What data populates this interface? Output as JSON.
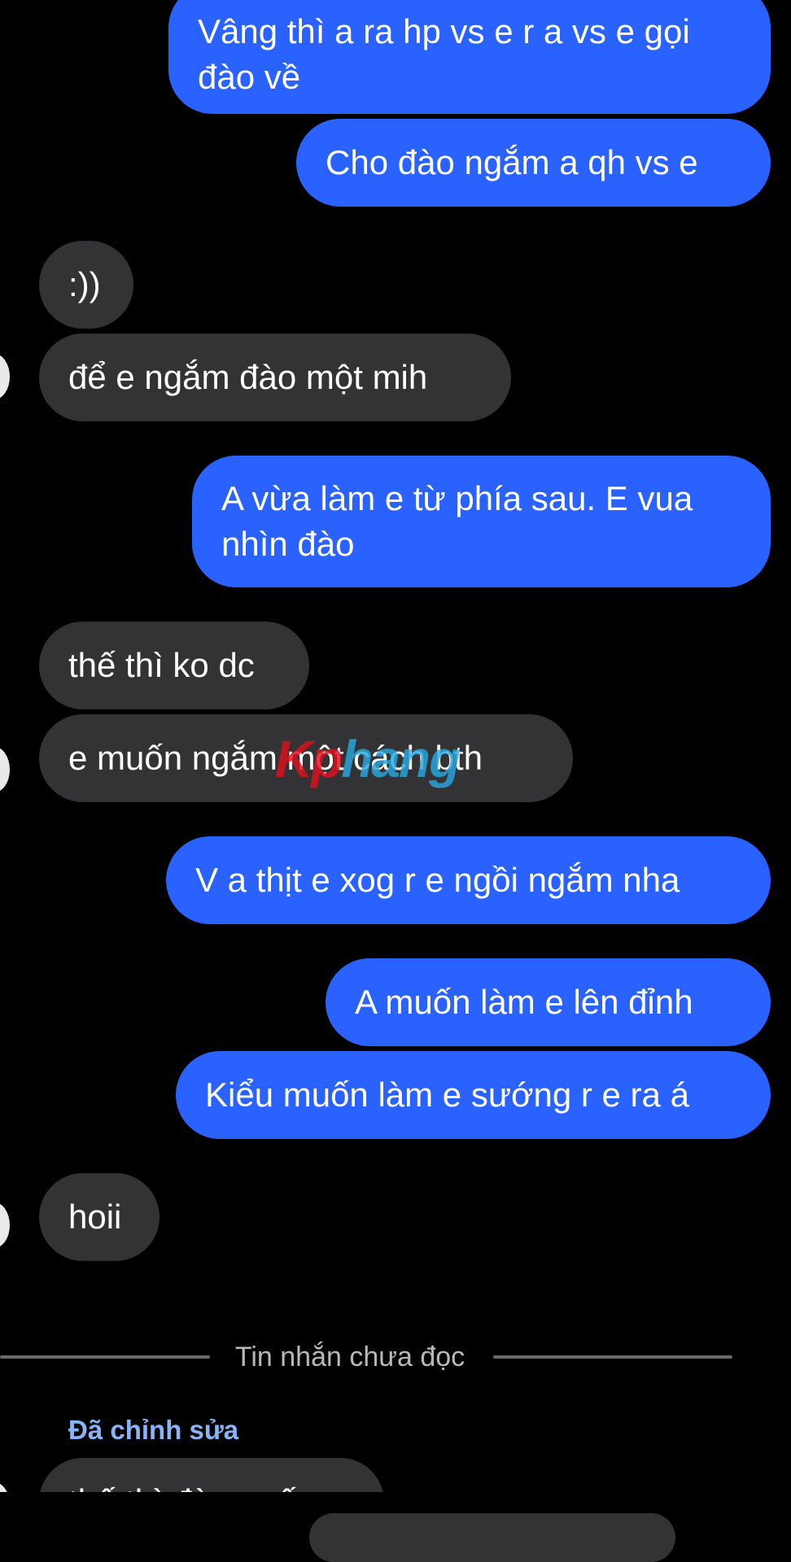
{
  "messages": [
    {
      "side": "sent",
      "text": "Vâng thì a ra hp vs e r a vs e gọi\nđào về"
    },
    {
      "side": "sent",
      "text": "Cho đào ngắm a qh vs e"
    },
    {
      "side": "received",
      "text": ":))"
    },
    {
      "side": "received",
      "text": "để e ngắm đào một mih"
    },
    {
      "side": "sent",
      "text": "A vừa làm e từ phía sau. E vua\nnhìn đào"
    },
    {
      "side": "received",
      "text": "thế thì ko dc"
    },
    {
      "side": "received",
      "text": "e muốn ngắm một cách bth"
    },
    {
      "side": "sent",
      "text": "V a thịt e xog r e ngồi ngắm nha"
    },
    {
      "side": "sent",
      "text": "A muốn làm e lên đỉnh"
    },
    {
      "side": "sent",
      "text": "Kiểu muốn làm e sướng r e ra á"
    },
    {
      "side": "received",
      "text": "hoii"
    },
    {
      "side": "received",
      "text": "thế thì đào ... ấy"
    }
  ],
  "unread_divider": "Tin nhắn chưa đọc",
  "edited_label": "Đã chỉnh sửa",
  "watermark": {
    "part1": "Kp",
    "part2": "hang"
  },
  "colors": {
    "sent_bubble": "#2962ff",
    "received_bubble": "#333335",
    "background": "#000000",
    "edited_label": "#8ab4f8"
  }
}
